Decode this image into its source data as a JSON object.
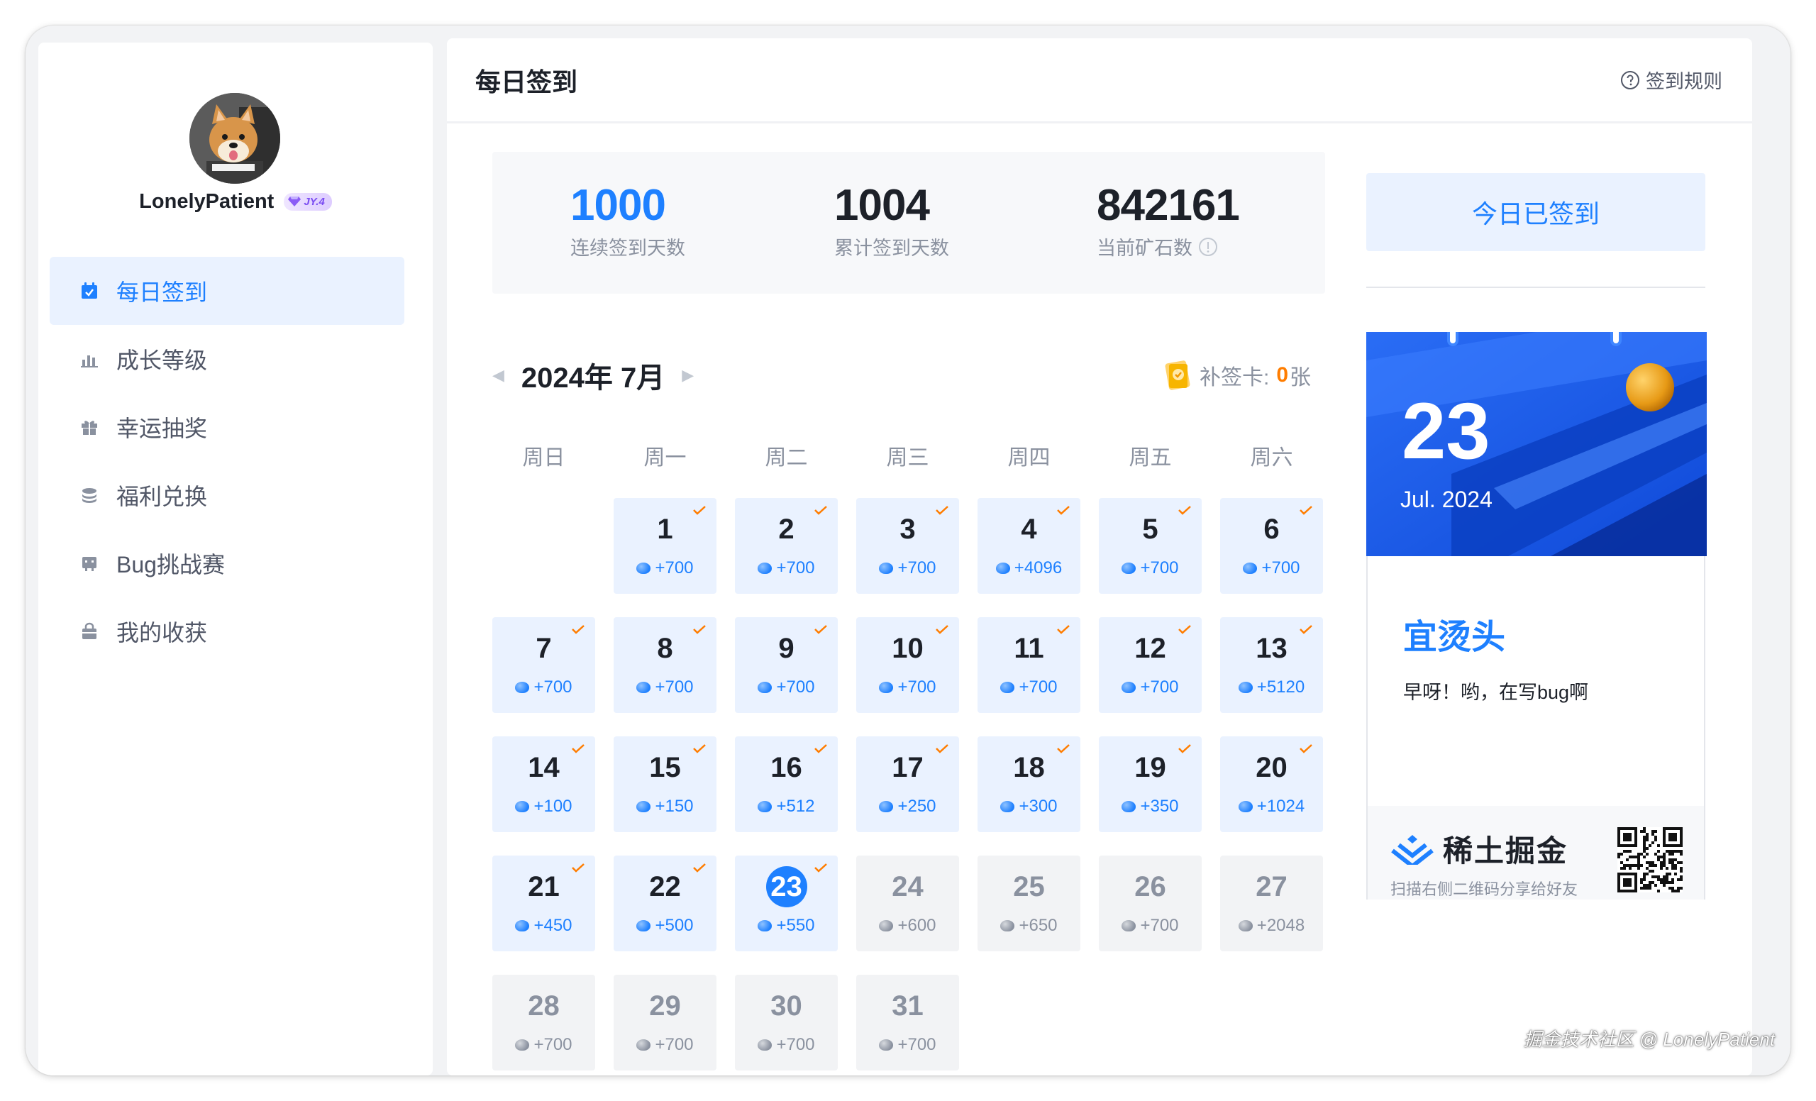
{
  "user": {
    "name": "LonelyPatient",
    "level": "JY.4"
  },
  "sidebar": {
    "items": [
      {
        "label": "每日签到",
        "icon": "calendar-check-icon",
        "active": true
      },
      {
        "label": "成长等级",
        "icon": "bar-chart-icon",
        "active": false
      },
      {
        "label": "幸运抽奖",
        "icon": "gift-icon",
        "active": false
      },
      {
        "label": "福利兑换",
        "icon": "coins-icon",
        "active": false
      },
      {
        "label": "Bug挑战赛",
        "icon": "bug-icon",
        "active": false
      },
      {
        "label": "我的收获",
        "icon": "bag-icon",
        "active": false
      }
    ]
  },
  "header": {
    "title": "每日签到",
    "rules_label": "签到规则"
  },
  "stats": [
    {
      "value": "1000",
      "label": "连续签到天数"
    },
    {
      "value": "1004",
      "label": "累计签到天数"
    },
    {
      "value": "842161",
      "label": "当前矿石数"
    }
  ],
  "calendar": {
    "month_title": "2024年 7月",
    "makeup_label": "补签卡:",
    "makeup_count": "0",
    "makeup_unit": "张",
    "weekdays": [
      "周日",
      "周一",
      "周二",
      "周三",
      "周四",
      "周五",
      "周六"
    ],
    "first_weekday": 1,
    "today": 23,
    "days": [
      {
        "day": "1",
        "reward": "+700",
        "signed": true
      },
      {
        "day": "2",
        "reward": "+700",
        "signed": true
      },
      {
        "day": "3",
        "reward": "+700",
        "signed": true
      },
      {
        "day": "4",
        "reward": "+4096",
        "signed": true
      },
      {
        "day": "5",
        "reward": "+700",
        "signed": true
      },
      {
        "day": "6",
        "reward": "+700",
        "signed": true
      },
      {
        "day": "7",
        "reward": "+700",
        "signed": true
      },
      {
        "day": "8",
        "reward": "+700",
        "signed": true
      },
      {
        "day": "9",
        "reward": "+700",
        "signed": true
      },
      {
        "day": "10",
        "reward": "+700",
        "signed": true
      },
      {
        "day": "11",
        "reward": "+700",
        "signed": true
      },
      {
        "day": "12",
        "reward": "+700",
        "signed": true
      },
      {
        "day": "13",
        "reward": "+5120",
        "signed": true
      },
      {
        "day": "14",
        "reward": "+100",
        "signed": true
      },
      {
        "day": "15",
        "reward": "+150",
        "signed": true
      },
      {
        "day": "16",
        "reward": "+512",
        "signed": true
      },
      {
        "day": "17",
        "reward": "+250",
        "signed": true
      },
      {
        "day": "18",
        "reward": "+300",
        "signed": true
      },
      {
        "day": "19",
        "reward": "+350",
        "signed": true
      },
      {
        "day": "20",
        "reward": "+1024",
        "signed": true
      },
      {
        "day": "21",
        "reward": "+450",
        "signed": true
      },
      {
        "day": "22",
        "reward": "+500",
        "signed": true
      },
      {
        "day": "23",
        "reward": "+550",
        "signed": true
      },
      {
        "day": "24",
        "reward": "+600",
        "signed": false
      },
      {
        "day": "25",
        "reward": "+650",
        "signed": false
      },
      {
        "day": "26",
        "reward": "+700",
        "signed": false
      },
      {
        "day": "27",
        "reward": "+2048",
        "signed": false
      },
      {
        "day": "28",
        "reward": "+700",
        "signed": false
      },
      {
        "day": "29",
        "reward": "+700",
        "signed": false
      },
      {
        "day": "30",
        "reward": "+700",
        "signed": false
      },
      {
        "day": "31",
        "reward": "+700",
        "signed": false
      }
    ]
  },
  "checkin": {
    "button_label": "今日已签到"
  },
  "daily_card": {
    "day": "23",
    "date": "Jul. 2024",
    "fortune": "宜烫头",
    "message": "早呀！哟，在写bug啊",
    "brand": "稀土掘金",
    "tip": "扫描右侧二维码分享给好友"
  },
  "watermark": "掘金技术社区 @ LonelyPatient",
  "colors": {
    "accent": "#1e80ff",
    "accent_light": "#eaf2ff",
    "check": "#ff7d00",
    "muted": "#8a919f"
  }
}
